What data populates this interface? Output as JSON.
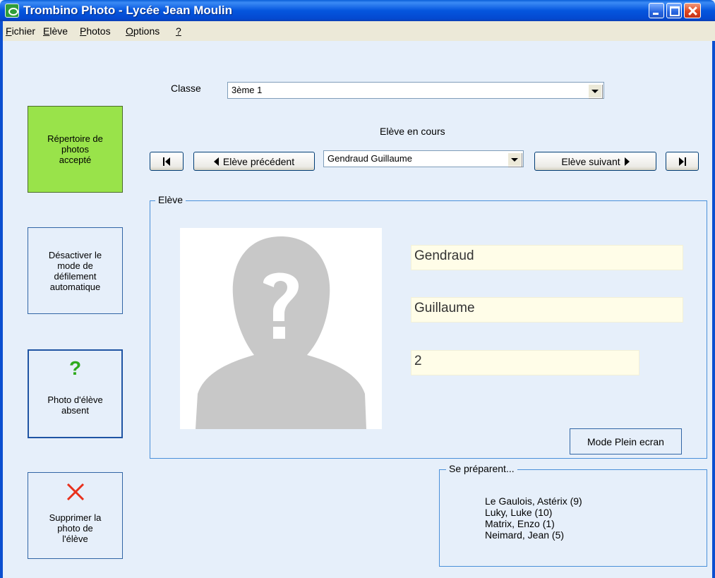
{
  "window": {
    "title": "Trombino Photo - Lycée Jean Moulin"
  },
  "menu": {
    "items": [
      {
        "label": "Fichier",
        "underline": "F",
        "rest": "ichier"
      },
      {
        "label": "Elève",
        "underline": "E",
        "rest": "lève"
      },
      {
        "label": "Photos",
        "underline": "P",
        "rest": "hotos"
      },
      {
        "label": "Options",
        "underline": "O",
        "rest": "ptions"
      },
      {
        "label": "?",
        "underline": "?",
        "rest": ""
      }
    ]
  },
  "sidebar": {
    "repertoire": [
      "Répertoire de",
      "photos",
      "accepté"
    ],
    "desactiver": [
      "Désactiver le",
      "mode de",
      "défilement",
      "automatique"
    ],
    "absent_icon": "?",
    "absent": [
      "Photo d'élève",
      "absent"
    ],
    "supprimer": [
      "Supprimer la",
      "photo de",
      "l'élève"
    ],
    "colors": {
      "accepted": "#99e34a",
      "absent_icon": "#2eaa1c",
      "delete_icon": "#e8301c"
    }
  },
  "classe": {
    "label": "Classe",
    "value": "3ème 1"
  },
  "navigation": {
    "heading": "Elève en cours",
    "prev_label": "Elève précédent",
    "next_label": "Elève suivant",
    "current_student": "Gendraud Guillaume"
  },
  "eleve_group": {
    "title": "Elève",
    "nom": "Gendraud",
    "prenom": "Guillaume",
    "numero": "2",
    "plein_ecran_label": "Mode Plein ecran",
    "photo_placeholder": "unknown-person-silhouette"
  },
  "preparing": {
    "title": "Se préparent...",
    "students": [
      "Le Gaulois, Astérix (9)",
      "Luky, Luke (10)",
      "Matrix, Enzo (1)",
      "Neimard, Jean (5)"
    ]
  }
}
